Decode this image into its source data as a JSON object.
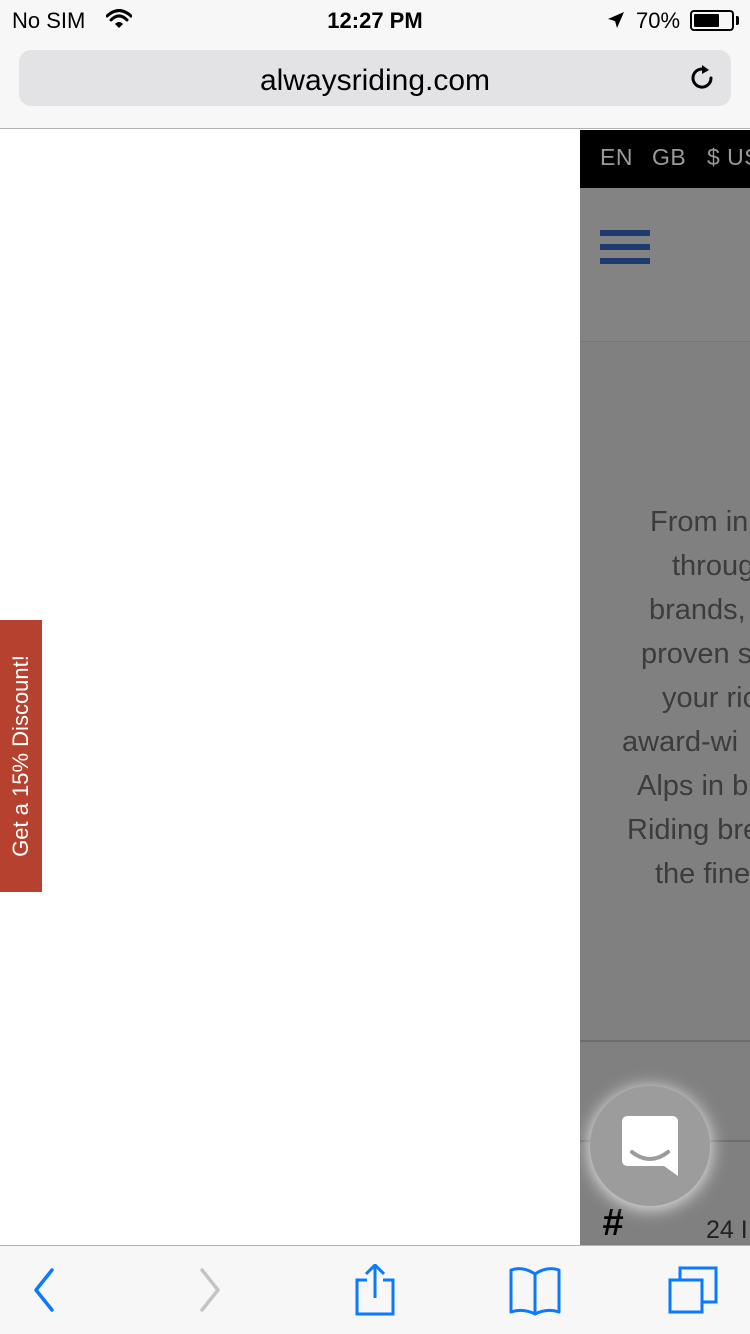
{
  "status_bar": {
    "carrier": "No SIM",
    "time": "12:27 PM",
    "battery_percent": "70%",
    "battery_level": 0.7,
    "icons": [
      "wifi-icon",
      "location-arrow-icon",
      "battery-icon"
    ]
  },
  "browser": {
    "url": "alwaysriding.com",
    "reload_icon": "reload-icon",
    "toolbar_icons": [
      "back-icon",
      "forward-icon",
      "share-icon",
      "bookmarks-icon",
      "tabs-icon"
    ]
  },
  "site": {
    "top_bar": {
      "language": "EN",
      "region": "GB",
      "currency": "$ US"
    },
    "menu_icon": "hamburger-menu-icon",
    "hero_lines": [
      "From in",
      "throug",
      "brands,",
      "proven s",
      "your ric",
      "award-wi",
      "Alps in b",
      "Riding bre",
      "the fine"
    ],
    "list_marker": "#",
    "list_number": "24 I"
  },
  "discount_tab": {
    "label": "Get a 15% Discount!"
  },
  "chat_launcher": {
    "icon": "chat-bubble-icon"
  },
  "colors": {
    "overlay_gray": "#808080",
    "site_top_bar": "#000000",
    "menu_icon": "#1e3a6e",
    "discount_tab": "#b5412e",
    "chat_launcher": "#9c9c9c",
    "ios_blue": "#0a7aff",
    "ios_disabled": "#c4c4c7"
  }
}
